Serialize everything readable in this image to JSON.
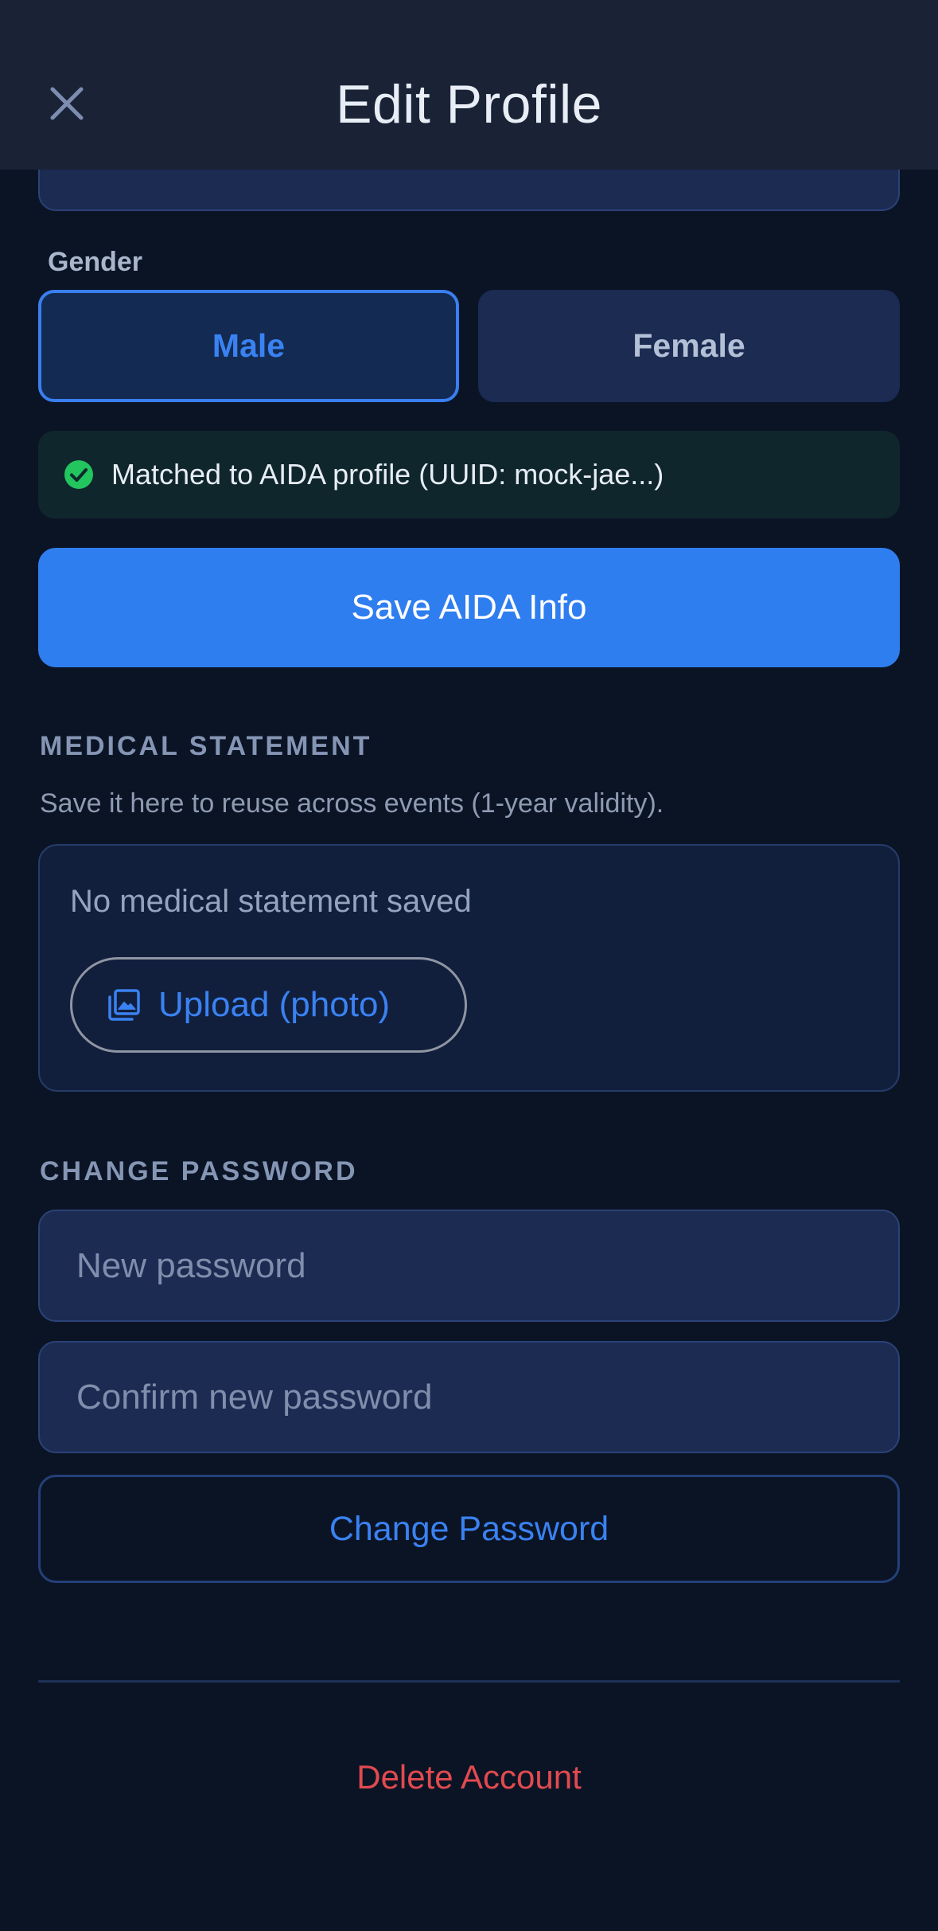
{
  "header": {
    "title": "Edit Profile",
    "close_icon": "close-icon"
  },
  "gender": {
    "label": "Gender",
    "options": [
      "Male",
      "Female"
    ],
    "selected": "Male"
  },
  "aida": {
    "match_text": "Matched to AIDA profile (UUID: mock-jae...)",
    "match_icon": "check-circle-icon",
    "save_label": "Save AIDA Info"
  },
  "medical": {
    "heading": "MEDICAL STATEMENT",
    "description": "Save it here to reuse across events (1-year validity).",
    "empty_text": "No medical statement saved",
    "upload_label": "Upload (photo)",
    "upload_icon": "photo-library-icon"
  },
  "password": {
    "heading": "CHANGE PASSWORD",
    "new_placeholder": "New password",
    "confirm_placeholder": "Confirm new password",
    "submit_label": "Change Password"
  },
  "danger": {
    "delete_label": "Delete Account"
  },
  "colors": {
    "background": "#0b1425",
    "header": "#1a2336",
    "accent": "#2f7ef0",
    "success": "#22c55e",
    "danger": "#e24a4f"
  }
}
